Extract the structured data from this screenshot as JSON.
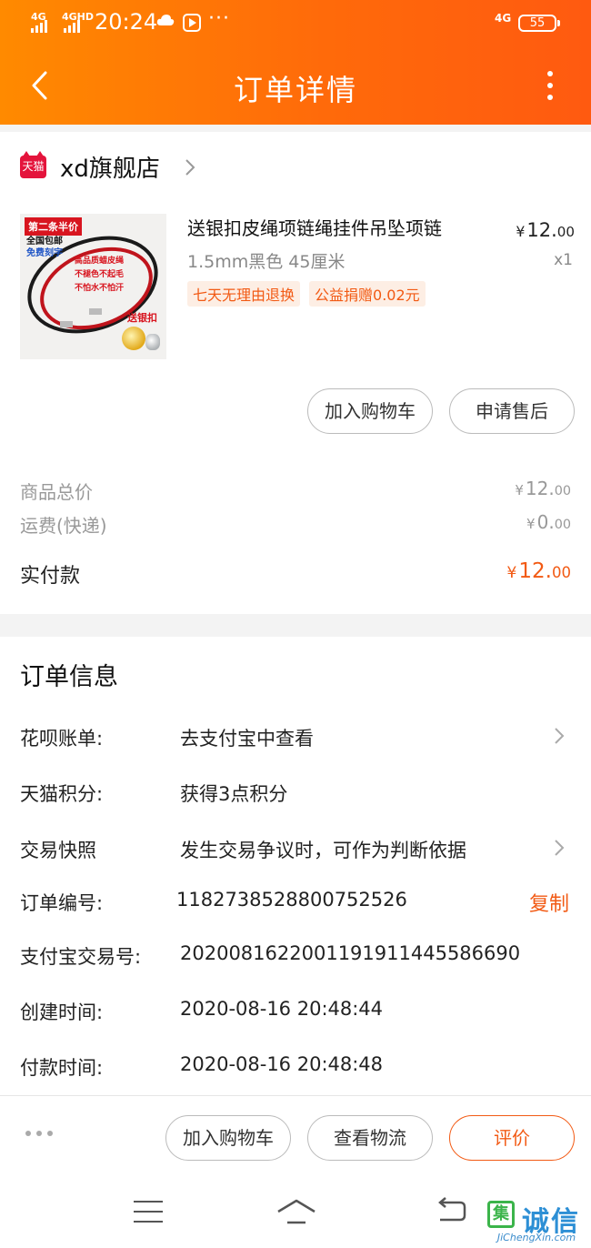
{
  "status_bar": {
    "signal_1": "4G",
    "signal_2": "4GHD",
    "time": "20:24",
    "network": "4G",
    "battery": "55"
  },
  "nav": {
    "title": "订单详情"
  },
  "shop": {
    "badge": "天猫",
    "name": "xd旗舰店"
  },
  "product": {
    "image_text": {
      "promo": "第二条半价",
      "line1": "全国包邮",
      "line2": "免费刻字",
      "feature1": "高品质蜡皮绳",
      "feature2": "不褪色不起毛",
      "feature3": "不怕水不怕汗",
      "gift": "送银扣"
    },
    "name": "送银扣皮绳项链绳挂件吊坠项链",
    "spec": "1.5mm黑色 45厘米",
    "price_currency": "¥",
    "price_int": "12.",
    "price_dec": "00",
    "quantity": "x1",
    "badges": [
      "七天无理由退换",
      "公益捐赠0.02元"
    ]
  },
  "item_actions": {
    "add_cart": "加入购物车",
    "after_sale": "申请售后"
  },
  "summary": {
    "goods_total_label": "商品总价",
    "goods_total_currency": "¥",
    "goods_total_int": "12.",
    "goods_total_dec": "00",
    "shipping_label": "运费(快递)",
    "shipping_currency": "¥",
    "shipping_int": "0.",
    "shipping_dec": "00",
    "paid_label": "实付款",
    "paid_currency": "¥",
    "paid_int": "12.",
    "paid_dec": "00"
  },
  "order_info": {
    "title": "订单信息",
    "rows": [
      {
        "label": "花呗账单:",
        "value": "去支付宝中查看"
      },
      {
        "label": "天猫积分:",
        "value": "获得3点积分"
      },
      {
        "label": "交易快照",
        "value": "发生交易争议时，可作为判断依据"
      },
      {
        "label": "订单编号:",
        "value": "1182738528800752526",
        "action": "复制"
      },
      {
        "label": "支付宝交易号:",
        "value": "2020081622001191911445586690"
      },
      {
        "label": "创建时间:",
        "value": "2020-08-16 20:48:44"
      },
      {
        "label": "付款时间:",
        "value": "2020-08-16 20:48:48"
      }
    ]
  },
  "bottom_actions": {
    "add_cart": "加入购物车",
    "logistics": "查看物流",
    "review": "评价"
  },
  "watermark": {
    "mark": "集",
    "text": "诚信",
    "url": "JiChengXin.com"
  },
  "colors": {
    "header_start": "#ff8a00",
    "header_end": "#ff5a10",
    "accent": "#f25a14",
    "tmall_red": "#e4143c"
  }
}
